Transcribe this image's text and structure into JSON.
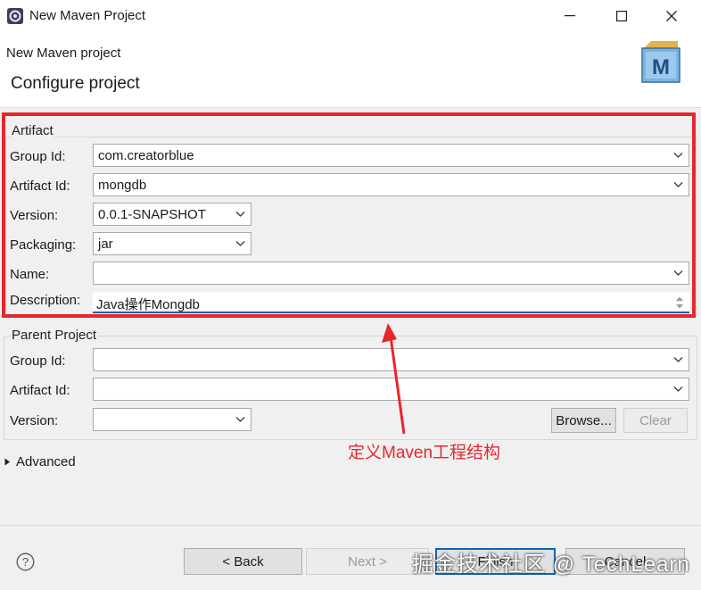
{
  "window": {
    "title": "New Maven Project",
    "icons": {
      "app": "gear-icon",
      "minimize": "minimize-icon",
      "maximize": "maximize-icon",
      "close": "close-icon"
    }
  },
  "header": {
    "subtitle": "New Maven project",
    "title": "Configure project",
    "logo_letter": "M"
  },
  "artifact": {
    "group_title": "Artifact",
    "group_id": {
      "label": "Group Id:",
      "value": "com.creatorblue"
    },
    "artifact_id": {
      "label": "Artifact Id:",
      "value": "mongdb"
    },
    "version": {
      "label": "Version:",
      "value": "0.0.1-SNAPSHOT"
    },
    "packaging": {
      "label": "Packaging:",
      "value": "jar"
    },
    "name": {
      "label": "Name:",
      "value": ""
    },
    "description": {
      "label": "Description:",
      "value": "Java操作Mongdb"
    }
  },
  "parent": {
    "group_title": "Parent Project",
    "group_id": {
      "label": "Group Id:",
      "value": ""
    },
    "artifact_id": {
      "label": "Artifact Id:",
      "value": ""
    },
    "version": {
      "label": "Version:",
      "value": ""
    },
    "browse_label": "Browse...",
    "clear_label": "Clear"
  },
  "advanced": {
    "label": "Advanced",
    "expanded": false
  },
  "annotation": {
    "text": "定义Maven工程结构",
    "color": "#e8262c"
  },
  "footer": {
    "help_icon": "help-icon",
    "back_label": "< Back",
    "next_label": "Next >",
    "finish_label": "Finish",
    "cancel_label": "Cancel"
  },
  "watermark": "掘金技术社区 @ TechLearn",
  "colors": {
    "highlight": "#e8262c",
    "focus_underline": "#1f5fa8",
    "background": "#f0f0f0"
  }
}
